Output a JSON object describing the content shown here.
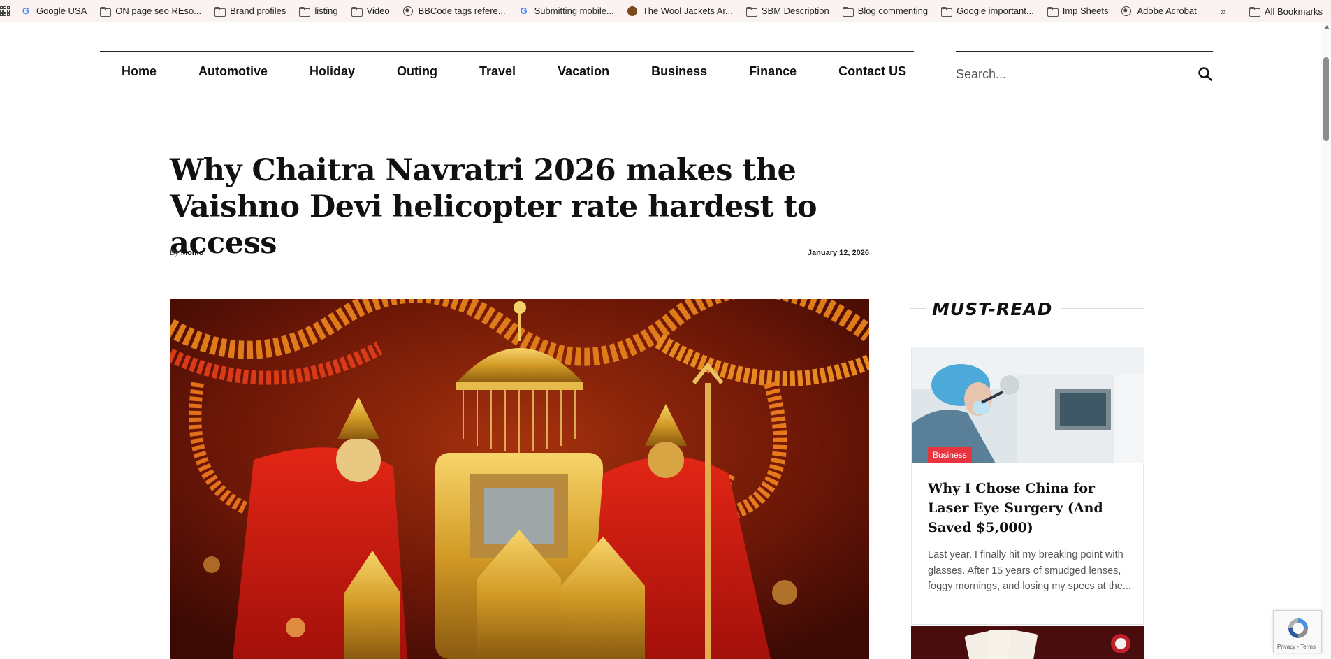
{
  "bookmarks": {
    "items": [
      {
        "label": "Google USA",
        "icon": "google-icon"
      },
      {
        "label": "ON page seo REso...",
        "icon": "folder-icon"
      },
      {
        "label": "Brand profiles",
        "icon": "folder-icon"
      },
      {
        "label": "listing",
        "icon": "folder-icon"
      },
      {
        "label": "Video",
        "icon": "folder-icon"
      },
      {
        "label": "BBCode tags refere...",
        "icon": "globe-icon"
      },
      {
        "label": "Submitting mobile...",
        "icon": "google-icon"
      },
      {
        "label": "The Wool Jackets Ar...",
        "icon": "site-icon"
      },
      {
        "label": "SBM Description",
        "icon": "folder-icon"
      },
      {
        "label": "Blog commenting",
        "icon": "folder-icon"
      },
      {
        "label": "Google important...",
        "icon": "folder-icon"
      },
      {
        "label": "Imp Sheets",
        "icon": "folder-icon"
      },
      {
        "label": "Adobe Acrobat",
        "icon": "globe-icon"
      }
    ],
    "overflow_glyph": "»",
    "all_bookmarks": "All Bookmarks"
  },
  "nav": {
    "items": [
      "Home",
      "Automotive",
      "Holiday",
      "Outing",
      "Travel",
      "Vacation",
      "Business",
      "Finance",
      "Contact US"
    ],
    "search_placeholder": "Search..."
  },
  "article": {
    "title": "Why Chaitra Navratri 2026 makes the Vaishno Devi helicopter rate hardest to access",
    "by_prefix": "By",
    "author": "Momo",
    "date": "January 12, 2026"
  },
  "sidebar": {
    "heading": "MUST-READ",
    "card": {
      "category": "Business",
      "title": "Why I Chose China for Laser Eye Surgery (And Saved $5,000)",
      "excerpt": "Last year, I finally hit my breaking point with glasses. After 15 years of smudged lenses, foggy mornings, and losing my specs at the..."
    }
  },
  "recaptcha": {
    "links": "Privacy - Terms"
  },
  "colors": {
    "badge": "#e8343f",
    "bookmark_bar": "#fbf3f1"
  }
}
